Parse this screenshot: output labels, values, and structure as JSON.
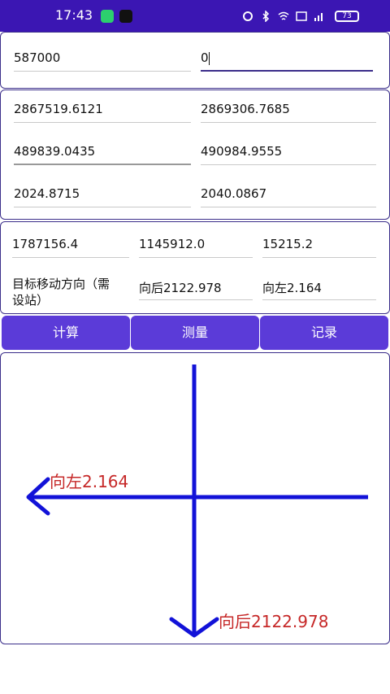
{
  "status_bar": {
    "time": "17:43",
    "battery": "73"
  },
  "top_inputs": {
    "left": "587000",
    "right": "0"
  },
  "coords": [
    {
      "left": "2867519.6121",
      "right": "2869306.7685"
    },
    {
      "left": "489839.0435",
      "right": "490984.9555"
    },
    {
      "left": "2024.8715",
      "right": "2040.0867"
    }
  ],
  "results": {
    "row1": [
      "1787156.4",
      "1145912.0",
      "15215.2"
    ],
    "direction_label_line1": "目标移动方向（需",
    "direction_label_line2": "设站）",
    "back_value": "向后2122.978",
    "left_value": "向左2.164"
  },
  "buttons": {
    "calculate": "计算",
    "measure": "测量",
    "record": "记录"
  },
  "canvas": {
    "left_caption": "向左2.164",
    "back_caption": "向后2122.978",
    "line_color": "#1212d8",
    "text_color": "#c62828"
  }
}
